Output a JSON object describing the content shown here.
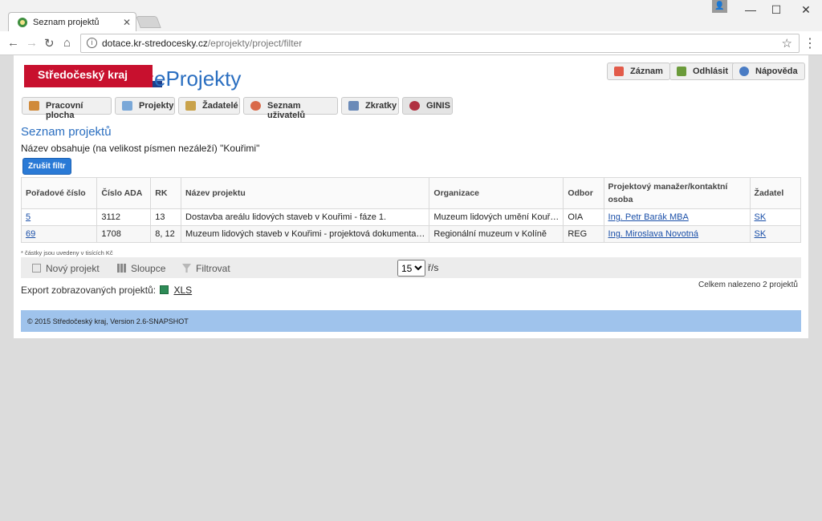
{
  "browser": {
    "tab_title": "Seznam projektů",
    "url_host": "dotace.kr-stredocesky.cz",
    "url_path": "/eprojekty/project/filter"
  },
  "header": {
    "logo_text": "Středočeský kraj",
    "brand": "eProjekty",
    "top_buttons": [
      "Záznam",
      "Odhlásit",
      "Nápověda"
    ]
  },
  "nav": [
    "Pracovní plocha",
    "Projekty",
    "Žadatelé",
    "Seznam uživatelů",
    "Zkratky",
    "GINIS"
  ],
  "main": {
    "title": "Seznam projektů",
    "filter_description": "Název obsahuje (na velikost písmen nezáleží) \"Kouřimi\"",
    "clear_filter_label": "Zrušit filtr",
    "columns": [
      "Pořadové číslo",
      "Číslo ADA",
      "RK",
      "Název projektu",
      "Organizace",
      "Odbor",
      "Projektový manažer/kontaktní osoba",
      "Žadatel"
    ],
    "rows": [
      [
        "5",
        "3112",
        "13",
        "Dostavba areálu lidových staveb v Kouřimi - fáze 1.",
        "Muzeum lidových umění Kouř…",
        "OIA",
        "Ing. Petr Barák MBA",
        "SK"
      ],
      [
        "69",
        "1708",
        "8, 12",
        "Muzeum lidových staveb v Kouřimi - projektová dokumenta…",
        "Regionální muzeum v Kolíně",
        "REG",
        "Ing. Miroslava Novotná",
        "SK"
      ]
    ],
    "note": "* částky jsou uvedeny v tisících Kč",
    "grid_actions": [
      "Nový projekt",
      "Sloupce",
      "Filtrovat"
    ],
    "page_size": "15",
    "page_size_unit": "ř/s",
    "export_label": "Export zobrazovaných projektů:",
    "export_format": "XLS",
    "total_found": "Celkem nalezeno 2 projektů"
  },
  "footer": {
    "text": "© 2015 Středočeský kraj, Version 2.6-SNAPSHOT"
  }
}
